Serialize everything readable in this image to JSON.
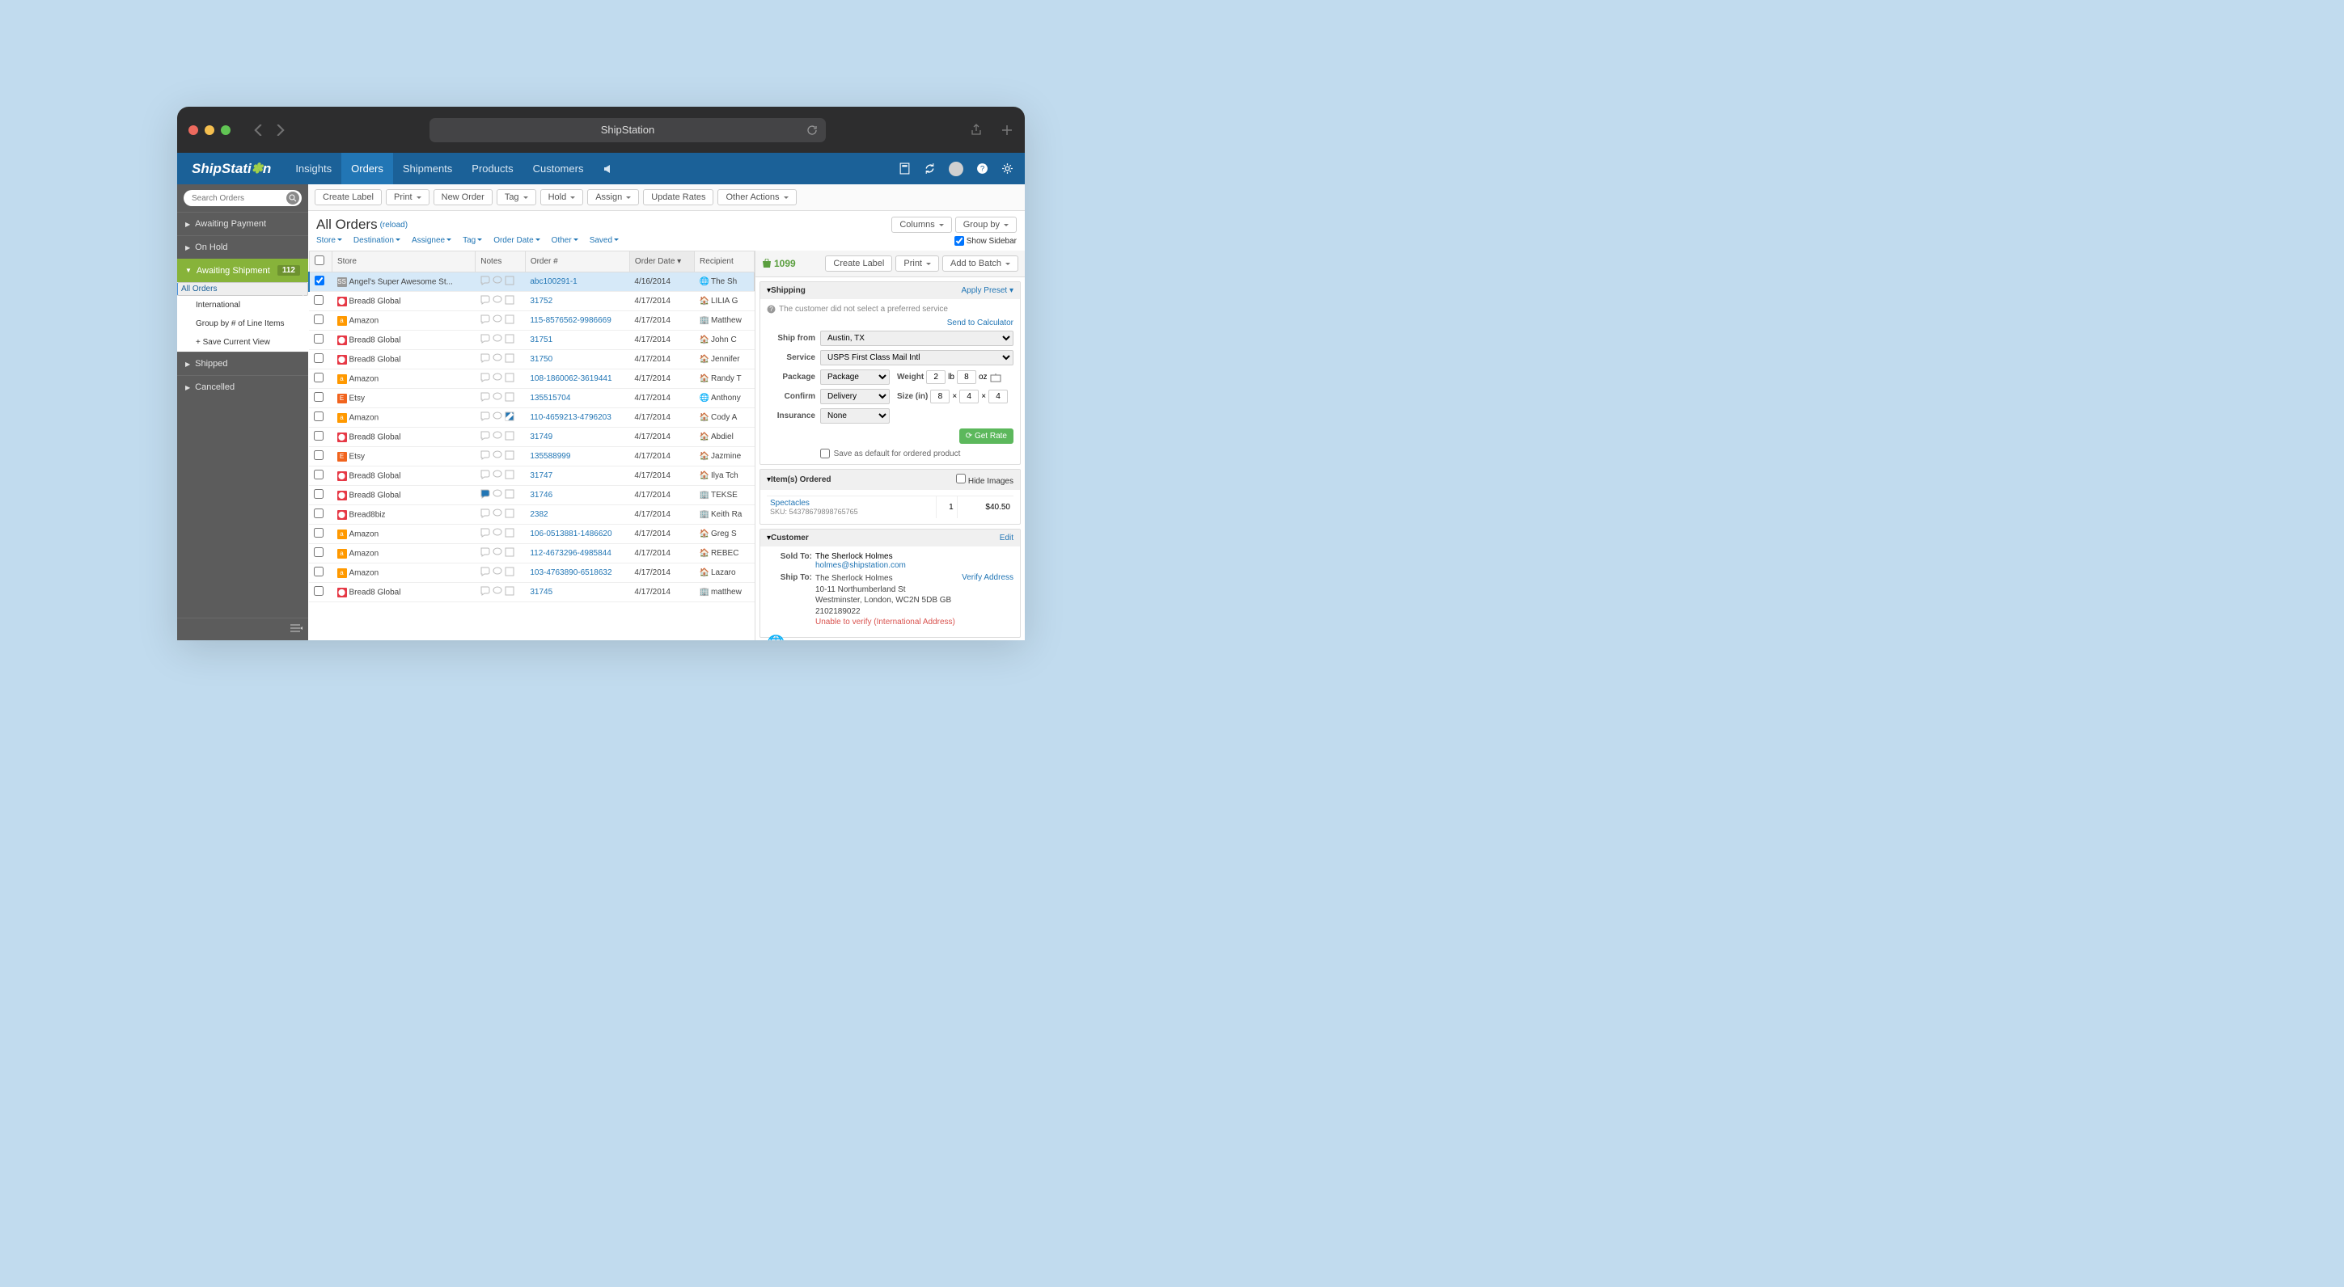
{
  "window": {
    "title": "ShipStation"
  },
  "logo": {
    "pre": "ShipStati",
    "gear": "✽",
    "post": "n"
  },
  "nav": [
    "Insights",
    "Orders",
    "Shipments",
    "Products",
    "Customers"
  ],
  "nav_active": 1,
  "search": {
    "placeholder": "Search Orders"
  },
  "side": {
    "sections": [
      {
        "label": "Awaiting Payment"
      },
      {
        "label": "On Hold"
      },
      {
        "label": "Awaiting Shipment",
        "expanded": true,
        "count": "112",
        "items": [
          {
            "label": "All Orders",
            "sel": true
          },
          {
            "label": "International"
          },
          {
            "label": "Group by # of Line Items"
          },
          {
            "label": "+ Save Current View"
          }
        ]
      },
      {
        "label": "Shipped"
      },
      {
        "label": "Cancelled"
      }
    ]
  },
  "toolbar": [
    "Create Label",
    "Print",
    "New Order",
    "Tag",
    "Hold",
    "Assign",
    "Update Rates",
    "Other Actions"
  ],
  "toolbar_dd": [
    false,
    true,
    false,
    true,
    true,
    true,
    false,
    true
  ],
  "header": {
    "title": "All Orders",
    "reload": "(reload)",
    "columns": "Columns",
    "groupby": "Group by",
    "showside": "Show Sidebar"
  },
  "filters": [
    "Store",
    "Destination",
    "Assignee",
    "Tag",
    "Order Date",
    "Other",
    "Saved"
  ],
  "cols": [
    "",
    "Store",
    "Notes",
    "Order #",
    "Order Date",
    "Recipient"
  ],
  "rows": [
    {
      "sel": true,
      "store": "Angel's Super Awesome St...",
      "sic": "ss",
      "order": "abc100291-1",
      "date": "4/16/2014",
      "rec": "The Sh",
      "ric": "🌐"
    },
    {
      "store": "Bread8 Global",
      "sic": "b",
      "order": "31752",
      "date": "4/17/2014",
      "rec": "LILIA G",
      "ric": "🏠"
    },
    {
      "store": "Amazon",
      "sic": "a",
      "order": "115-8576562-9986669",
      "date": "4/17/2014",
      "rec": "Matthew",
      "ric": "🏢"
    },
    {
      "store": "Bread8 Global",
      "sic": "b",
      "order": "31751",
      "date": "4/17/2014",
      "rec": "John C",
      "ric": "🏠"
    },
    {
      "store": "Bread8 Global",
      "sic": "b",
      "order": "31750",
      "date": "4/17/2014",
      "rec": "Jennifer",
      "ric": "🏠"
    },
    {
      "store": "Amazon",
      "sic": "a",
      "order": "108-1860062-3619441",
      "date": "4/17/2014",
      "rec": "Randy T",
      "ric": "🏠"
    },
    {
      "store": "Etsy",
      "sic": "e",
      "order": "135515704",
      "date": "4/17/2014",
      "rec": "Anthony",
      "ric": "🌐"
    },
    {
      "store": "Amazon",
      "sic": "a",
      "order": "110-4659213-4796203",
      "date": "4/17/2014",
      "rec": "Cody A",
      "ric": "🏠",
      "note": "blue"
    },
    {
      "store": "Bread8 Global",
      "sic": "b",
      "order": "31749",
      "date": "4/17/2014",
      "rec": "Abdiel",
      "ric": "🏠"
    },
    {
      "store": "Etsy",
      "sic": "e",
      "order": "135588999",
      "date": "4/17/2014",
      "rec": "Jazmine",
      "ric": "🏠"
    },
    {
      "store": "Bread8 Global",
      "sic": "b",
      "order": "31747",
      "date": "4/17/2014",
      "rec": "Ilya Tch",
      "ric": "🏠"
    },
    {
      "store": "Bread8 Global",
      "sic": "b",
      "order": "31746",
      "date": "4/17/2014",
      "rec": "TEKSE",
      "ric": "🏢",
      "note": "comment"
    },
    {
      "store": "Bread8biz",
      "sic": "b",
      "order": "2382",
      "date": "4/17/2014",
      "rec": "Keith Ra",
      "ric": "🏢"
    },
    {
      "store": "Amazon",
      "sic": "a",
      "order": "106-0513881-1486620",
      "date": "4/17/2014",
      "rec": "Greg S",
      "ric": "🏠"
    },
    {
      "store": "Amazon",
      "sic": "a",
      "order": "112-4673296-4985844",
      "date": "4/17/2014",
      "rec": "REBEC",
      "ric": "🏠"
    },
    {
      "store": "Amazon",
      "sic": "a",
      "order": "103-4763890-6518632",
      "date": "4/17/2014",
      "rec": "Lazaro",
      "ric": "🏠"
    },
    {
      "store": "Bread8 Global",
      "sic": "b",
      "order": "31745",
      "date": "4/17/2014",
      "rec": "matthew",
      "ric": "🏢"
    }
  ],
  "detail": {
    "count": "1099",
    "btns": [
      "Create Label",
      "Print",
      "Add to Batch"
    ],
    "btns_dd": [
      false,
      true,
      true
    ],
    "shipping": {
      "title": "Shipping",
      "preset": "Apply Preset",
      "warn": "The customer did not select a preferred service",
      "sendcalc": "Send to Calculator",
      "from_lbl": "Ship from",
      "from": "Austin, TX",
      "svc_lbl": "Service",
      "svc": "USPS First Class Mail Intl",
      "pkg_lbl": "Package",
      "pkg": "Package",
      "cfm_lbl": "Confirm",
      "cfm": "Delivery",
      "ins_lbl": "Insurance",
      "ins": "None",
      "wt_lbl": "Weight",
      "wt_lb": "2",
      "wt_oz": "8",
      "lb": "lb",
      "oz": "oz",
      "sz_lbl": "Size (in)",
      "l": "8",
      "w": "4",
      "h": "4",
      "rate": "Get Rate",
      "save_def": "Save as default for ordered product"
    },
    "items": {
      "title": "Item(s) Ordered",
      "hide": "Hide Images",
      "name": "Spectacles",
      "sku": "SKU: 54378679898765765",
      "qty": "1",
      "price": "$40.50"
    },
    "cust": {
      "title": "Customer",
      "edit": "Edit",
      "sold_lbl": "Sold To:",
      "name": "The Sherlock Holmes",
      "email": "holmes@shipstation.com",
      "ship_lbl": "Ship To:",
      "verify": "Verify Address",
      "addr1": "The Sherlock Holmes",
      "addr2": "10-11 Northumberland St",
      "addr3": "Westminster, London, WC2N 5DB GB",
      "addr4": "2102189022",
      "unv": "Unable to verify (International Address)"
    }
  }
}
